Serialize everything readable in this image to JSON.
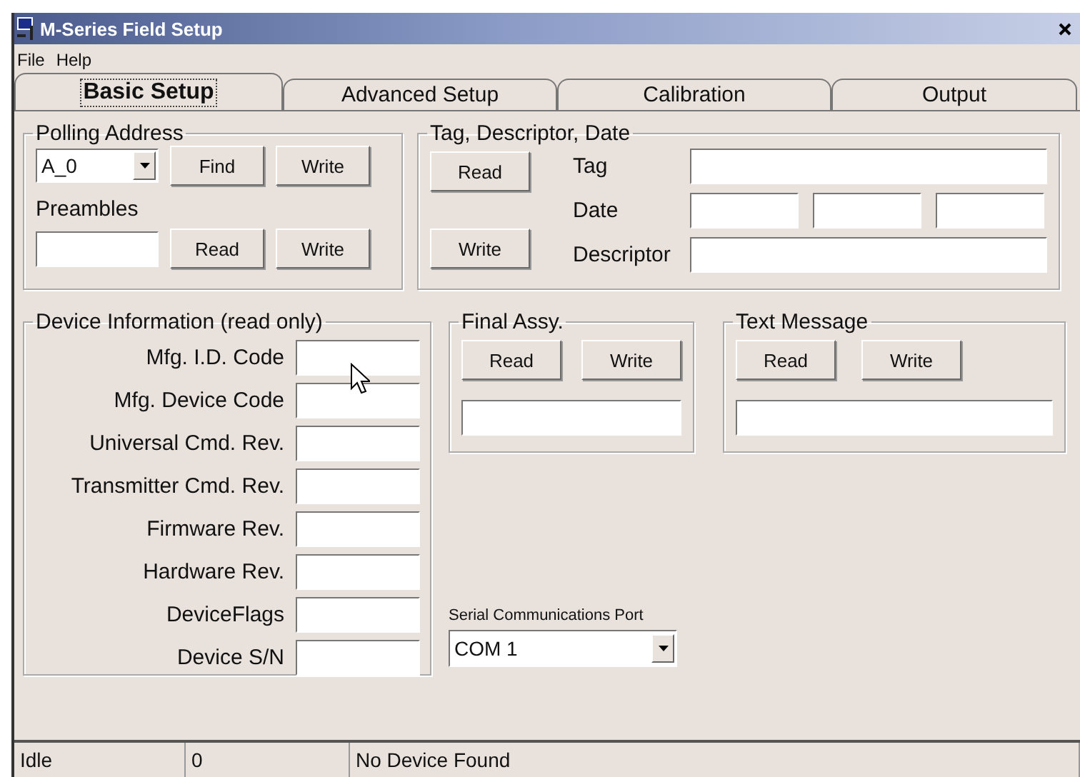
{
  "window": {
    "title": "M-Series Field Setup"
  },
  "menu": [
    "File",
    "Help"
  ],
  "tabs": [
    {
      "label": "Basic Setup",
      "selected": true
    },
    {
      "label": "Advanced Setup",
      "selected": false
    },
    {
      "label": "Calibration",
      "selected": false
    },
    {
      "label": "Output",
      "selected": false
    }
  ],
  "polling_address": {
    "title": "Polling Address",
    "address": {
      "value": "A_0"
    },
    "address_buttons": [
      "Find",
      "Write"
    ],
    "preambles_label": "Preambles",
    "preamble_buttons": [
      "Read",
      "Write"
    ]
  },
  "tag_descriptor_date": {
    "title": "Tag, Descriptor, Date",
    "buttons": [
      "Read",
      "Write"
    ],
    "fields": [
      {
        "label": "Tag",
        "kind": "single"
      },
      {
        "label": "Date",
        "kind": "date"
      },
      {
        "label": "Descriptor",
        "kind": "single"
      }
    ]
  },
  "device_information": {
    "title": "Device Information (read only)",
    "fields": [
      "Mfg. I.D. Code",
      "Mfg. Device Code",
      "Universal Cmd. Rev.",
      "Transmitter Cmd. Rev.",
      "Firmware Rev.",
      "Hardware Rev.",
      "DeviceFlags",
      "Device S/N"
    ]
  },
  "final_assy": {
    "title": "Final Assy.",
    "buttons": [
      "Read",
      "Write"
    ]
  },
  "text_message": {
    "title": "Text Message",
    "buttons": [
      "Read",
      "Write"
    ]
  },
  "serial_port": {
    "label": "Serial Communications Port",
    "value": "COM 1"
  },
  "status_bar": [
    "Idle",
    "0",
    "No Device Found"
  ]
}
